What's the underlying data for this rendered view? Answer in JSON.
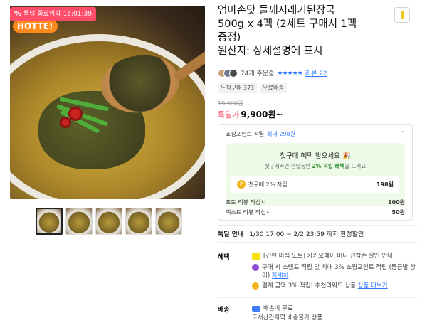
{
  "deal_badge": {
    "label": "특딜 종료임박",
    "timer": "16:01:39"
  },
  "brand_logo": "HOTTE!",
  "thumbnails": [
    {
      "alt": "product-1",
      "active": true
    },
    {
      "alt": "product-2"
    },
    {
      "alt": "product-3"
    },
    {
      "alt": "product-4"
    },
    {
      "alt": "product-5"
    }
  ],
  "product": {
    "title_line1": "엄마손맛 들깨시래기된장국",
    "title_line2": "500g x 4팩 (2세트 구매시 1팩",
    "title_line3": "증정)",
    "title_line4": "원산지: 상세설명에 표시"
  },
  "reviews": {
    "order_count": "74개 주문중",
    "stars": "★★★★★",
    "review_link": "리뷰 22"
  },
  "tags": [
    "누적구매 373",
    "무료배송"
  ],
  "pricing": {
    "original": "19,900원",
    "label": "톡딜가",
    "price": "9,900원~"
  },
  "points": {
    "header": "쇼핑포인트 적립",
    "max": "최대 298원",
    "first_buy_title": "첫구매 혜택 받으세요",
    "first_buy_sub_pre": "첫구매라면 한달동안",
    "first_buy_sub_hl": "2% 적립 혜택",
    "first_buy_sub_post": "을 드려요",
    "first_buy_row_label": "첫구매 2% 적립",
    "first_buy_row_amount": "198원",
    "photo_review_label": "포토 리뷰 작성시",
    "photo_review_amount": "100원",
    "text_review_label": "텍스트 리뷰 작성시",
    "text_review_amount": "50원"
  },
  "deal_period": {
    "label": "톡딜 안내",
    "value": "1/30 17:00 ~ 2/2 23:59 까지 한정할인"
  },
  "benefits": {
    "label": "혜택",
    "items": [
      {
        "text": "[간편 미식 노트] 카카오페이 머니 선착순 할인 안내",
        "link": ""
      },
      {
        "text": "구매 시 스탬프 적립 및 최대 3% 쇼핑포인트 적립 (등급별 상이)",
        "link": "자세히"
      },
      {
        "text": "결제 금액 3% 적립! 추천리워드 상품",
        "link": "상품 더보기"
      }
    ]
  },
  "shipping": {
    "label": "배송",
    "line1": "배송비 무료",
    "line2": "도서산간지역 배송불가 상품"
  }
}
